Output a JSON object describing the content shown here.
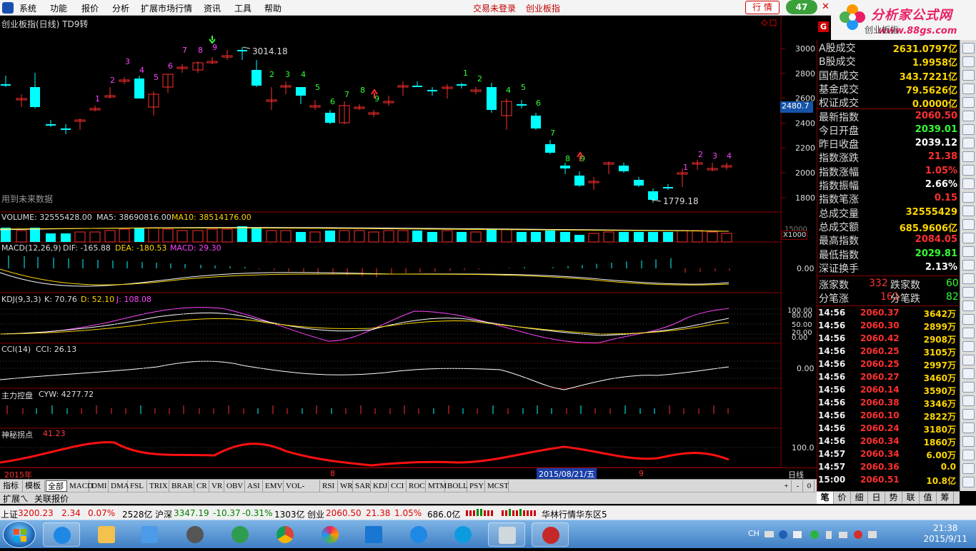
{
  "menu": {
    "items": [
      "系统",
      "功能",
      "报价",
      "分析",
      "扩展市场行情",
      "资讯",
      "工具",
      "帮助"
    ],
    "status_login": "交易未登录",
    "status_index": "创业板指",
    "hq_button": "行 情",
    "badge_count": "47"
  },
  "brand": {
    "name": "分析家公式网",
    "url": "www.88gs.com"
  },
  "chart": {
    "title": "创业板指(日线) TD9转",
    "future_data_note": "用到未来数据",
    "high_label": "3014.18",
    "low_label": "1779.18",
    "price_axis": [
      "3000",
      "2800",
      "2600",
      "2400",
      "2200",
      "2000",
      "1800"
    ],
    "current_price": "2480.7",
    "volume_header": {
      "volume": "VOLUME: 32555428.00",
      "ma5": "MA5: 38690816.00",
      "ma10": "MA10: 38514176.00"
    },
    "volume_axis_top": "15000",
    "volume_unit": "X1000",
    "macd_header": {
      "name": "MACD(12,26,9)",
      "dif": "DIF: -165.88",
      "dea": "DEA: -180.53",
      "macd": "MACD: 29.30"
    },
    "macd_axis": "0.00",
    "kdj_header": {
      "name": "KDJ(9,3,3)",
      "k": "K: 70.76",
      "d": "D: 52.10",
      "j": "J: 108.08"
    },
    "kdj_axis": [
      "100.00",
      "80.00",
      "50.00",
      "20.00",
      "0.00"
    ],
    "cci_header": {
      "name": "CCI(14)",
      "cci": "CCI: 26.13"
    },
    "cci_axis": "0.00",
    "cyw_header": {
      "name": "主力控盘",
      "cyw": "CYW: 4277.72"
    },
    "smgd_header": {
      "name": "神秘拐点",
      "value": "41.23"
    },
    "smgd_axis": "100.0",
    "date_axis": {
      "year": "2015年",
      "month8": "8",
      "cursor_date": "2015/08/21/五",
      "month9": "9",
      "period": "日线"
    },
    "td_labels_green": [
      "1",
      "2",
      "3",
      "4",
      "5",
      "6",
      "7",
      "8",
      "9"
    ],
    "td_labels_red": [
      "1",
      "2",
      "3",
      "4",
      "5",
      "6",
      "7",
      "8",
      "9"
    ]
  },
  "right_panel": {
    "logo_letter": "G",
    "title_ghost": "创业板指",
    "summary": [
      {
        "label": "A股成交",
        "value": "2631.0797亿",
        "color": "#ffd700"
      },
      {
        "label": "B股成交",
        "value": "1.9958亿",
        "color": "#ffd700"
      },
      {
        "label": "国债成交",
        "value": "343.7221亿",
        "color": "#ffd700"
      },
      {
        "label": "基金成交",
        "value": "79.5626亿",
        "color": "#ffd700"
      },
      {
        "label": "权证成交",
        "value": "0.0000亿",
        "color": "#ffd700"
      }
    ],
    "quote": [
      {
        "label": "最新指数",
        "value": "2060.50",
        "color": "#ff3030"
      },
      {
        "label": "今日开盘",
        "value": "2039.01",
        "color": "#33ff33"
      },
      {
        "label": "昨日收盘",
        "value": "2039.12",
        "color": "#ffffff"
      },
      {
        "label": "指数涨跌",
        "value": "21.38",
        "color": "#ff3030"
      },
      {
        "label": "指数涨幅",
        "value": "1.05%",
        "color": "#ff3030"
      },
      {
        "label": "指数振幅",
        "value": "2.66%",
        "color": "#ffffff"
      },
      {
        "label": "指数笔涨",
        "value": "0.15",
        "color": "#ff3030"
      },
      {
        "label": "总成交量",
        "value": "32555429",
        "color": "#ffd700"
      },
      {
        "label": "总成交额",
        "value": "685.9606亿",
        "color": "#ffd700"
      },
      {
        "label": "最高指数",
        "value": "2084.05",
        "color": "#ff3030"
      },
      {
        "label": "最低指数",
        "value": "2029.81",
        "color": "#33ff33"
      },
      {
        "label": "深证换手",
        "value": "2.13%",
        "color": "#ffffff"
      }
    ],
    "breadth": {
      "up_label": "涨家数",
      "up": "332",
      "down_label": "跌家数",
      "down": "60",
      "tick_up_label": "分笔涨",
      "tick_up": "161",
      "tick_down_label": "分笔跌",
      "tick_down": "82"
    },
    "ticks": [
      {
        "time": "14:56",
        "price": "2060.37",
        "qty": "3642万"
      },
      {
        "time": "14:56",
        "price": "2060.30",
        "qty": "2899万"
      },
      {
        "time": "14:56",
        "price": "2060.42",
        "qty": "2908万"
      },
      {
        "time": "14:56",
        "price": "2060.25",
        "qty": "3105万"
      },
      {
        "time": "14:56",
        "price": "2060.25",
        "qty": "2997万"
      },
      {
        "time": "14:56",
        "price": "2060.27",
        "qty": "3460万"
      },
      {
        "time": "14:56",
        "price": "2060.14",
        "qty": "3590万"
      },
      {
        "time": "14:56",
        "price": "2060.38",
        "qty": "3346万"
      },
      {
        "time": "14:56",
        "price": "2060.10",
        "qty": "2822万"
      },
      {
        "time": "14:56",
        "price": "2060.24",
        "qty": "3180万"
      },
      {
        "time": "14:56",
        "price": "2060.34",
        "qty": "1860万"
      },
      {
        "time": "14:57",
        "price": "2060.34",
        "qty": "6.00万"
      },
      {
        "time": "14:57",
        "price": "2060.36",
        "qty": "0.0"
      },
      {
        "time": "15:00",
        "price": "2060.51",
        "qty": "10.8亿"
      }
    ],
    "tabs": [
      "笔",
      "价",
      "细",
      "日",
      "势",
      "联",
      "值",
      "筹"
    ]
  },
  "indicator_tabs": [
    "指标",
    "模板",
    "全部",
    "MACD",
    "DMI",
    "DMA",
    "FSL",
    "TRIX",
    "BRAR",
    "CR",
    "VR",
    "OBV",
    "ASI",
    "EMV",
    "VOL-TDX",
    "RSI",
    "WR",
    "SAR",
    "KDJ",
    "CCI",
    "ROC",
    "MTM",
    "BOLL",
    "PSY",
    "MCST"
  ],
  "indicator_nav": [
    "+",
    "-",
    "0"
  ],
  "sub_tabs": [
    "扩展ㄟ",
    "关联报价"
  ],
  "market_bar": {
    "sh_label": "上证",
    "sh_price": "3200.23",
    "sh_chg": "2.34",
    "sh_pct": "0.07%",
    "sh_amt": "2528亿",
    "hs_label": "沪深",
    "hs_price": "3347.19",
    "hs_chg": "-10.37",
    "hs_pct": "-0.31%",
    "hs_amt": "1303亿",
    "cy_label": "创业",
    "cy_price": "2060.50",
    "cy_chg": "21.38",
    "cy_pct": "1.05%",
    "cy_amt": "686.0亿",
    "server": "华林行情华东区5"
  },
  "taskbar": {
    "lang": "CH",
    "time": "21:38",
    "date": "2015/9/11"
  }
}
